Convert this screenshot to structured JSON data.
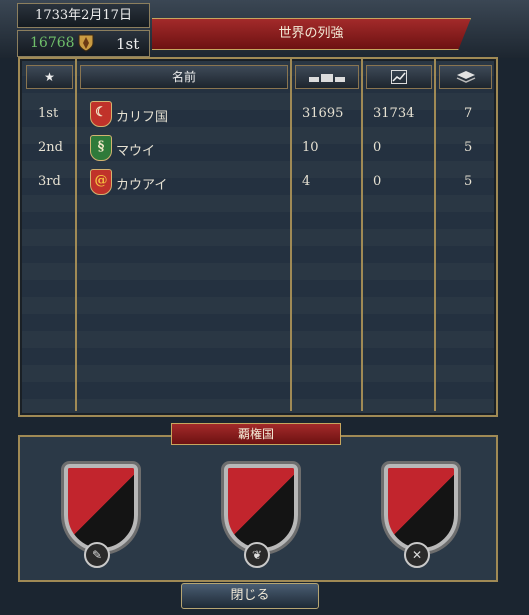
{
  "header": {
    "date": "1733年2月17日",
    "score": "16768",
    "rank": "1st",
    "title": "世界の列強"
  },
  "columns": {
    "rank_icon": "star-icon",
    "name": "名前",
    "col3_icon": "army-icon",
    "col4_icon": "trend-icon",
    "col5_icon": "stack-icon"
  },
  "rows": [
    {
      "rank": "1st",
      "name": "カリフ国",
      "v1": "31695",
      "v2": "31734",
      "v3": "7",
      "shield_color": "#c0322a",
      "shield_glyph": "☾"
    },
    {
      "rank": "2nd",
      "name": "マウイ",
      "v1": "10",
      "v2": "0",
      "v3": "5",
      "shield_color": "#2f7a3a",
      "shield_glyph": "§"
    },
    {
      "rank": "3rd",
      "name": "カウアイ",
      "v1": "4",
      "v2": "0",
      "v3": "5",
      "shield_color": "#c0322a",
      "shield_glyph": "@"
    }
  ],
  "hegemony": {
    "title": "覇権国",
    "slots": [
      {
        "icon": "✎"
      },
      {
        "icon": "❦"
      },
      {
        "icon": "✕"
      }
    ]
  },
  "close_label": "閉じる"
}
